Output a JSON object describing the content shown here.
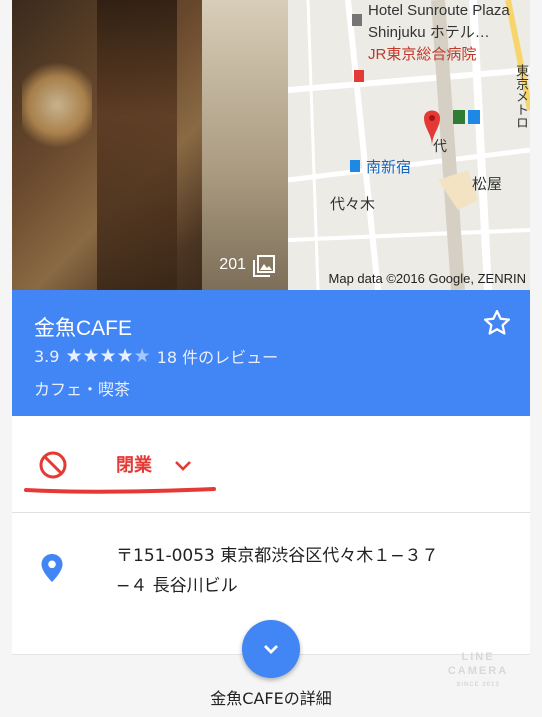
{
  "hero": {
    "photo_count": "201",
    "map": {
      "hotel_line1": "Hotel Sunroute Plaza",
      "hotel_line2": "Shinjuku ホテル…",
      "hospital": "JR東京総合病院",
      "dai_label": "代",
      "minami_shinjuku": "南新宿",
      "yoyogi": "代々木",
      "matsuya": "松屋",
      "vertical_road": "東京メトロ",
      "credit": "Map data ©2016 Google, ZENRIN"
    }
  },
  "place": {
    "name": "金魚CAFE",
    "rating": "3.9",
    "stars_filled": 4,
    "reviews": "18 件のレビュー",
    "category": "カフェ・喫茶"
  },
  "status": {
    "label": "閉業"
  },
  "address": {
    "line1": "〒151-0053 東京都渋谷区代々木１−３７",
    "line2": "−４ 長谷川ビル"
  },
  "details": {
    "label": "金魚CAFEの詳細"
  },
  "watermark": {
    "line1": "LINE",
    "line2": "CAMERA",
    "line3": "SINCE 2013"
  },
  "colors": {
    "accent": "#4285f4",
    "closed_red": "#e53935"
  }
}
